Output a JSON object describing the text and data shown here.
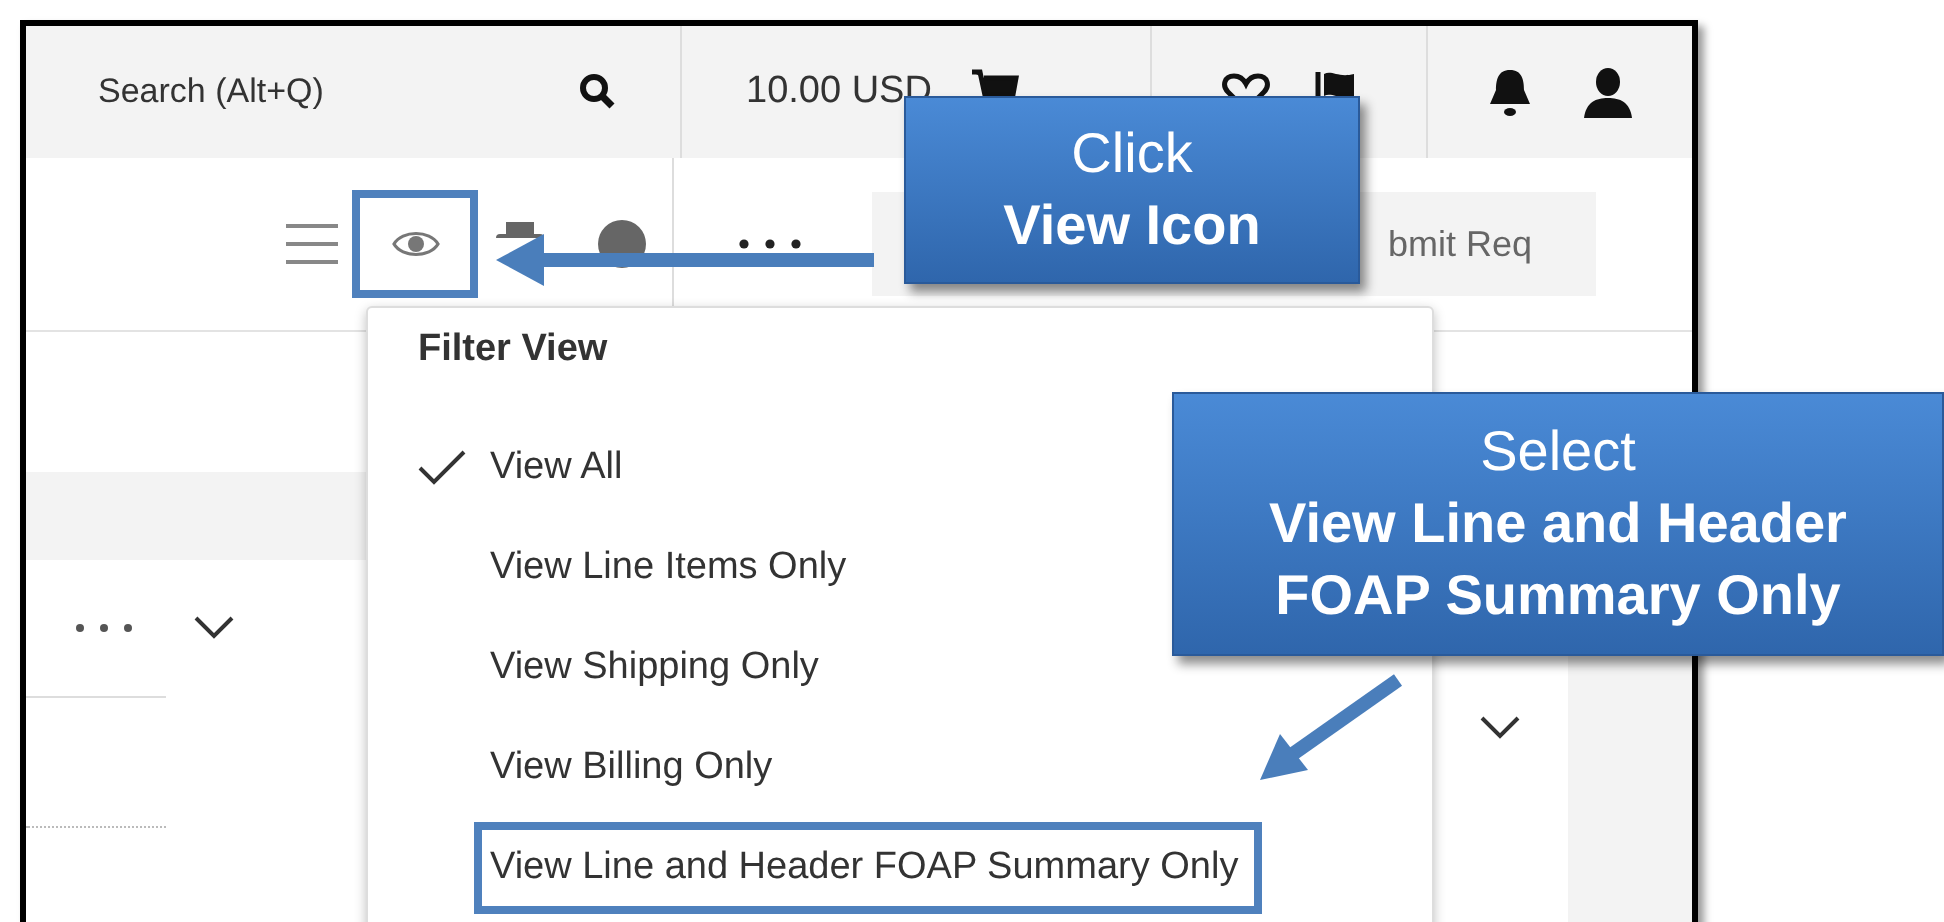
{
  "header": {
    "search": {
      "placeholder": "Search (Alt+Q)"
    },
    "cart_total": "10.00 USD"
  },
  "toolbar": {
    "view_icon_highlighted": true,
    "submit_button": "bmit Req"
  },
  "filter_menu": {
    "title": "Filter View",
    "items": [
      {
        "label": "View All",
        "selected": true,
        "highlighted": false
      },
      {
        "label": "View Line Items Only",
        "selected": false,
        "highlighted": false
      },
      {
        "label": "View Shipping Only",
        "selected": false,
        "highlighted": false
      },
      {
        "label": "View Billing Only",
        "selected": false,
        "highlighted": false
      },
      {
        "label": "View Line and Header FOAP Summary Only",
        "selected": false,
        "highlighted": true
      }
    ]
  },
  "callouts": [
    {
      "kind": "click",
      "lines": [
        {
          "text": "Click",
          "bold": false
        },
        {
          "text": "View Icon",
          "bold": true
        }
      ]
    },
    {
      "kind": "select",
      "lines": [
        {
          "text": "Select",
          "bold": false
        },
        {
          "text": "View Line and Header",
          "bold": true
        },
        {
          "text": "FOAP Summary Only",
          "bold": true
        }
      ]
    }
  ]
}
